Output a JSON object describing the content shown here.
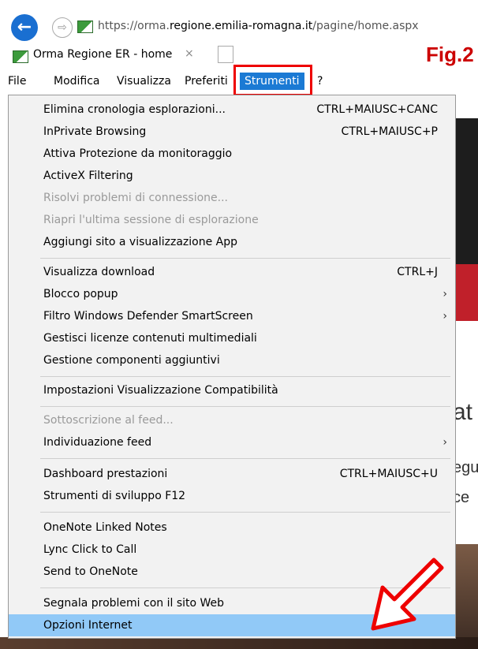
{
  "browser": {
    "url_prefix": "https://orma.",
    "url_host": "regione.emilia-romagna.it",
    "url_path": "/pagine/home.aspx",
    "tab_title": "Orma Regione ER - home",
    "tab_close": "×",
    "back_icon": "←",
    "forward_icon": "⇨"
  },
  "annotation": {
    "fig_label": "Fig.2"
  },
  "menubar": {
    "file": "File",
    "modifica": "Modifica",
    "visualizza": "Visualizza",
    "preferiti": "Preferiti",
    "strumenti": "Strumenti",
    "help": "?"
  },
  "menu": {
    "items": [
      {
        "label": "Elimina cronologia esplorazioni...",
        "shortcut": "CTRL+MAIUSC+CANC"
      },
      {
        "label": "InPrivate Browsing",
        "shortcut": "CTRL+MAIUSC+P"
      },
      {
        "label": "Attiva Protezione da monitoraggio",
        "shortcut": ""
      },
      {
        "label": "ActiveX Filtering",
        "shortcut": ""
      },
      {
        "label": "Risolvi problemi di connessione...",
        "shortcut": ""
      },
      {
        "label": "Riapri l'ultima sessione di esplorazione",
        "shortcut": ""
      },
      {
        "label": "Aggiungi sito a visualizzazione App",
        "shortcut": ""
      },
      {
        "label": "Visualizza download",
        "shortcut": "CTRL+J"
      },
      {
        "label": "Blocco popup",
        "shortcut": "›"
      },
      {
        "label": "Filtro Windows Defender SmartScreen",
        "shortcut": "›"
      },
      {
        "label": "Gestisci licenze contenuti multimediali",
        "shortcut": ""
      },
      {
        "label": "Gestione componenti aggiuntivi",
        "shortcut": ""
      },
      {
        "label": "Impostazioni Visualizzazione Compatibilità",
        "shortcut": ""
      },
      {
        "label": "Sottoscrizione al feed...",
        "shortcut": ""
      },
      {
        "label": "Individuazione feed",
        "shortcut": "›"
      },
      {
        "label": "Dashboard prestazioni",
        "shortcut": "CTRL+MAIUSC+U"
      },
      {
        "label": "Strumenti di sviluppo F12",
        "shortcut": ""
      },
      {
        "label": "OneNote Linked Notes",
        "shortcut": ""
      },
      {
        "label": "Lync Click to Call",
        "shortcut": ""
      },
      {
        "label": "Send to OneNote",
        "shortcut": ""
      },
      {
        "label": "Segnala problemi con il sito Web",
        "shortcut": ""
      },
      {
        "label": "Opzioni Internet",
        "shortcut": ""
      }
    ]
  },
  "background_text": {
    "t1": "at",
    "t2": "egu",
    "t3": "ce"
  },
  "colors": {
    "accent": "#1b7ad4",
    "highlight": "#91c9f7",
    "annotation_red": "#e00000"
  }
}
